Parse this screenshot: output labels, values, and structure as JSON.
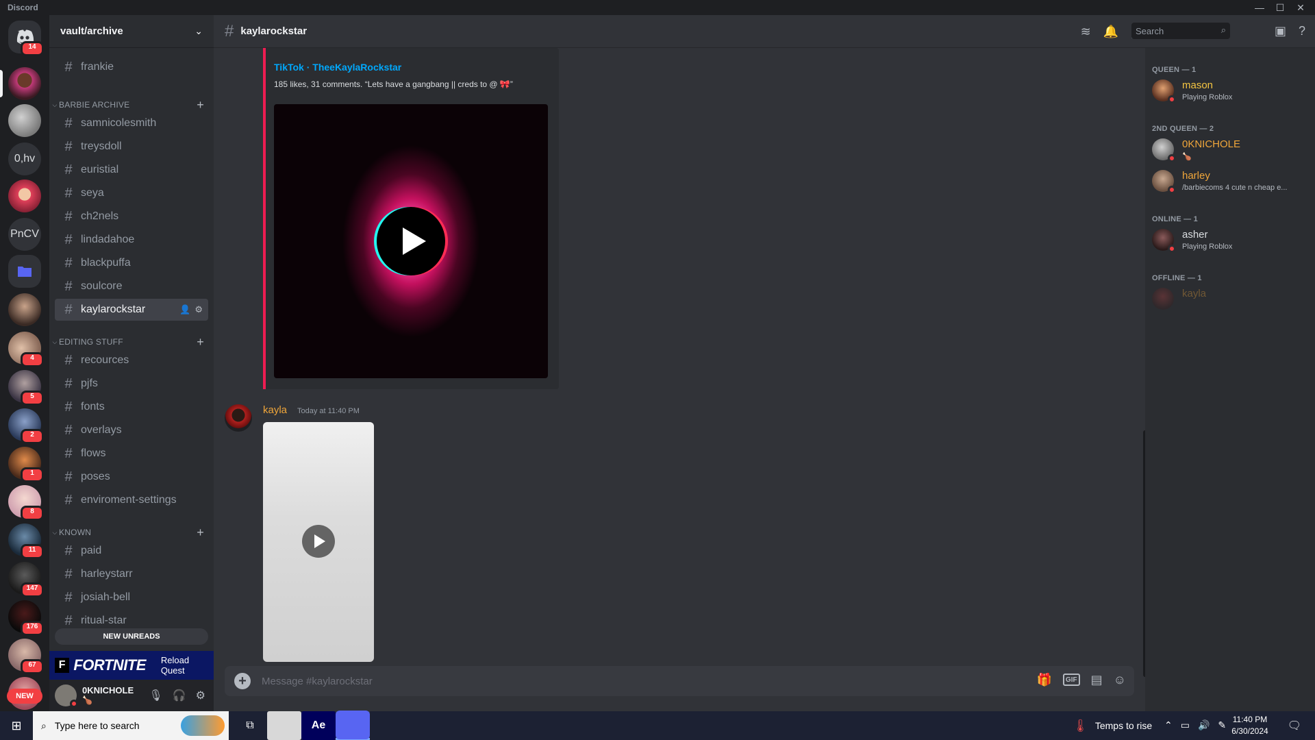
{
  "app_title": "Discord",
  "window_controls": [
    "—",
    "☐",
    "✕"
  ],
  "rail": {
    "home_badge": "14",
    "text_servers": [
      "0,hv",
      "PnCV"
    ],
    "badges": [
      "4",
      "5",
      "2",
      "1",
      "8",
      "11",
      "147",
      "176",
      "67"
    ],
    "new_label": "NEW"
  },
  "server": {
    "name": "vault/archive",
    "top_channel": "frankie",
    "categories": [
      {
        "name": "BARBIE ARCHIVE",
        "channels": [
          "samnicolesmith",
          "treysdoll",
          "euristial",
          "seya",
          "ch2nels",
          "lindadahoe",
          "blackpuffa",
          "soulcore",
          "kaylarockstar"
        ]
      },
      {
        "name": "EDITING STUFF",
        "channels": [
          "recources",
          "pjfs",
          "fonts",
          "overlays",
          "flows",
          "poses",
          "enviroment-settings"
        ]
      },
      {
        "name": "KNOWN",
        "channels": [
          "paid",
          "harleystarr",
          "josiah-bell",
          "ritual-star"
        ]
      }
    ],
    "new_unreads": "NEW UNREADS",
    "quest": {
      "brand": "FORTNITE",
      "logo_letter": "F",
      "action": "Reload Quest"
    }
  },
  "current_user": {
    "name": "0KNICHOLE",
    "status_emoji": "🍗"
  },
  "channel": {
    "name": "kaylarockstar",
    "search_placeholder": "Search",
    "composer_placeholder": "Message #kaylarockstar",
    "gif_label": "GIF"
  },
  "embed": {
    "author": "TikTok · TheeKaylaRockstar",
    "description": "185 likes, 31 comments. “Lets have a gangbang || creds to @ 🎀”",
    "accent": "#ee1d52"
  },
  "message": {
    "author": "kayla",
    "timestamp": "Today at 11:40 PM",
    "author_color": "#f0a63a"
  },
  "members": {
    "groups": [
      {
        "title": "QUEEN — 1",
        "members": [
          {
            "name": "mason",
            "activity": "Playing Roblox",
            "color": "#f5c542"
          }
        ]
      },
      {
        "title": "2ND QUEEN — 2",
        "members": [
          {
            "name": "0KNICHOLE",
            "activity": "🍗",
            "color": "#f0a63a"
          },
          {
            "name": "harley",
            "activity": "/barbiecoms 4 cute n cheap e...",
            "color": "#f0a63a"
          }
        ]
      },
      {
        "title": "ONLINE — 1",
        "members": [
          {
            "name": "asher",
            "activity": "Playing Roblox",
            "color": "#dbdee1"
          }
        ]
      },
      {
        "title": "OFFLINE — 1",
        "members": [
          {
            "name": "kayla",
            "activity": "",
            "color": "#f0a63a"
          }
        ]
      }
    ]
  },
  "taskbar": {
    "search_placeholder": "Type here to search",
    "ae_label": "Ae",
    "weather": "Temps to rise",
    "time": "11:40 PM",
    "date": "6/30/2024"
  }
}
